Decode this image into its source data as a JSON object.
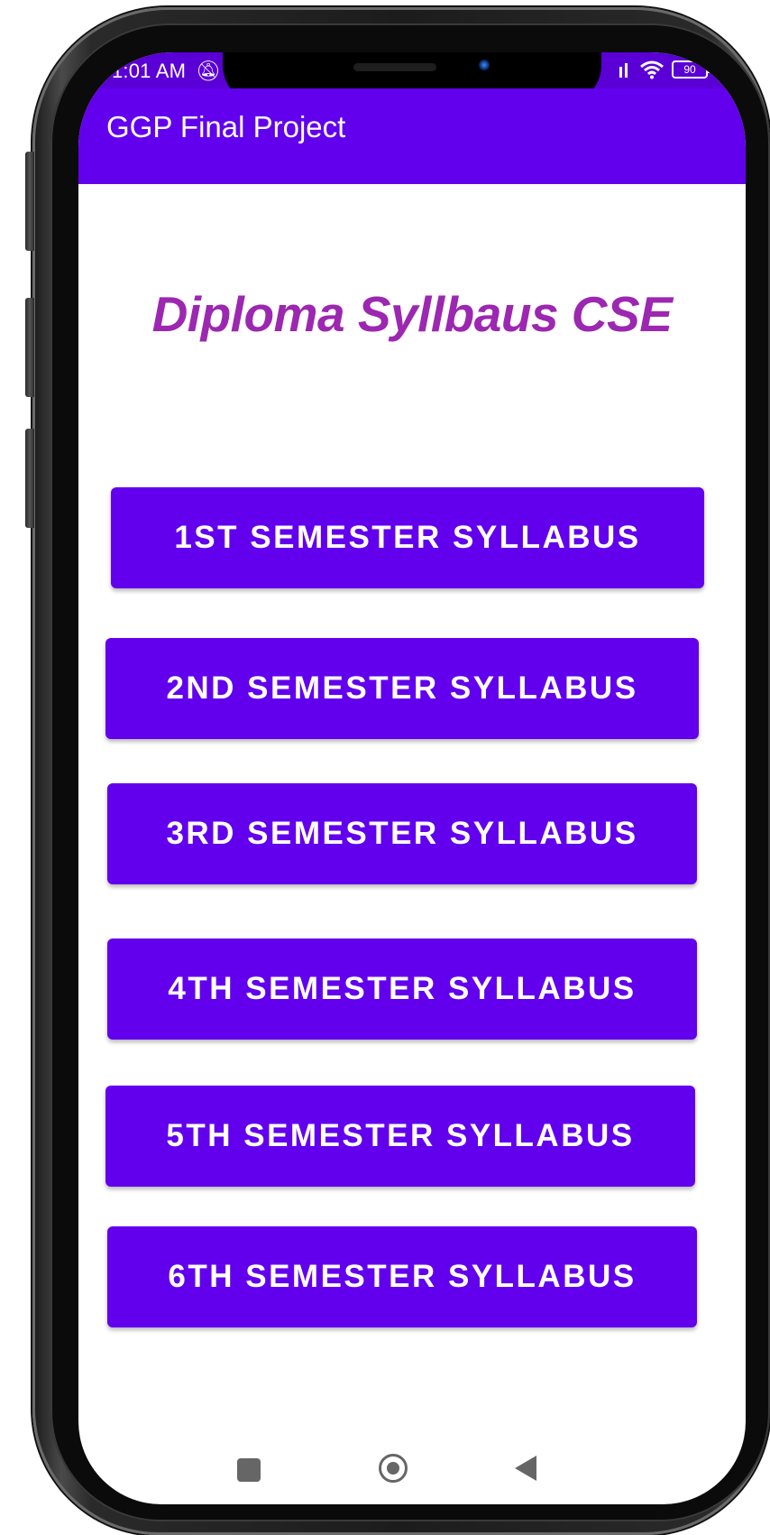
{
  "status_bar": {
    "time": "1:01 AM",
    "dnd_icon": "do-not-disturb-off-icon",
    "battery_level": "90",
    "icons": [
      "signal-icon",
      "wifi-icon",
      "battery-icon"
    ]
  },
  "app_bar": {
    "title": "GGP Final Project"
  },
  "main": {
    "heading": "Diploma Syllbaus CSE",
    "buttons": [
      {
        "label": "1ST SEMESTER SYLLABUS"
      },
      {
        "label": "2ND SEMESTER SYLLABUS"
      },
      {
        "label": "3RD SEMESTER SYLLABUS"
      },
      {
        "label": "4TH SEMESTER SYLLABUS"
      },
      {
        "label": "5TH SEMESTER SYLLABUS"
      },
      {
        "label": "6TH SEMESTER SYLLABUS"
      }
    ]
  },
  "nav_bar": {
    "icons": [
      "recents-icon",
      "home-icon",
      "back-icon"
    ]
  },
  "colors": {
    "primary": "#6200ee",
    "status_bar": "#5a00d6",
    "heading": "#9c27b0",
    "button_text": "#ffffff"
  }
}
